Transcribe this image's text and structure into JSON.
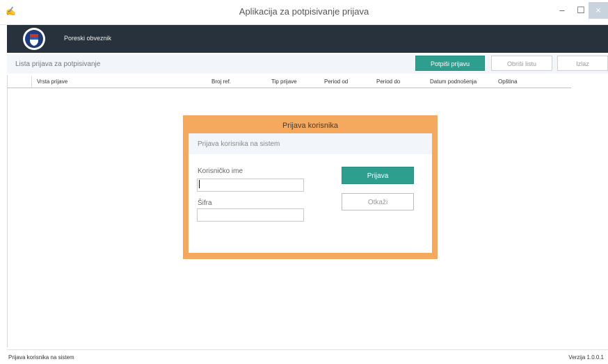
{
  "window": {
    "title": "Aplikacija za potpisivanje prijava",
    "minimize_glyph": "–",
    "maximize_glyph": "☐",
    "close_glyph": "×"
  },
  "banner": {
    "org_name": "Poreski obveznik",
    "logo_icon": "coat-of-arms-icon"
  },
  "toolbar": {
    "list_title": "Lista prijava za potpisivanje",
    "sign_label": "Potpiši prijavu",
    "clear_label": "Obriši listu",
    "exit_label": "Izlaz"
  },
  "grid": {
    "columns": [
      "Vrsta prijave",
      "Broj ref.",
      "Tip prijave",
      "Period od",
      "Period do",
      "Datum podnošenja",
      "Opština"
    ]
  },
  "login_dialog": {
    "title": "Prijava korisnika",
    "subtitle": "Prijava korisnika na sistem",
    "username_label": "Korisničko ime",
    "username_value": "",
    "password_label": "Šifra",
    "password_value": "",
    "login_label": "Prijava",
    "cancel_label": "Otkaži"
  },
  "statusbar": {
    "status": "Prijava korisnika na sistem",
    "version": "Verzija 1.0.0.1"
  },
  "colors": {
    "accent_green": "#2e9e8f",
    "dialog_orange": "#f5a95e",
    "banner_dark": "#27323c"
  }
}
